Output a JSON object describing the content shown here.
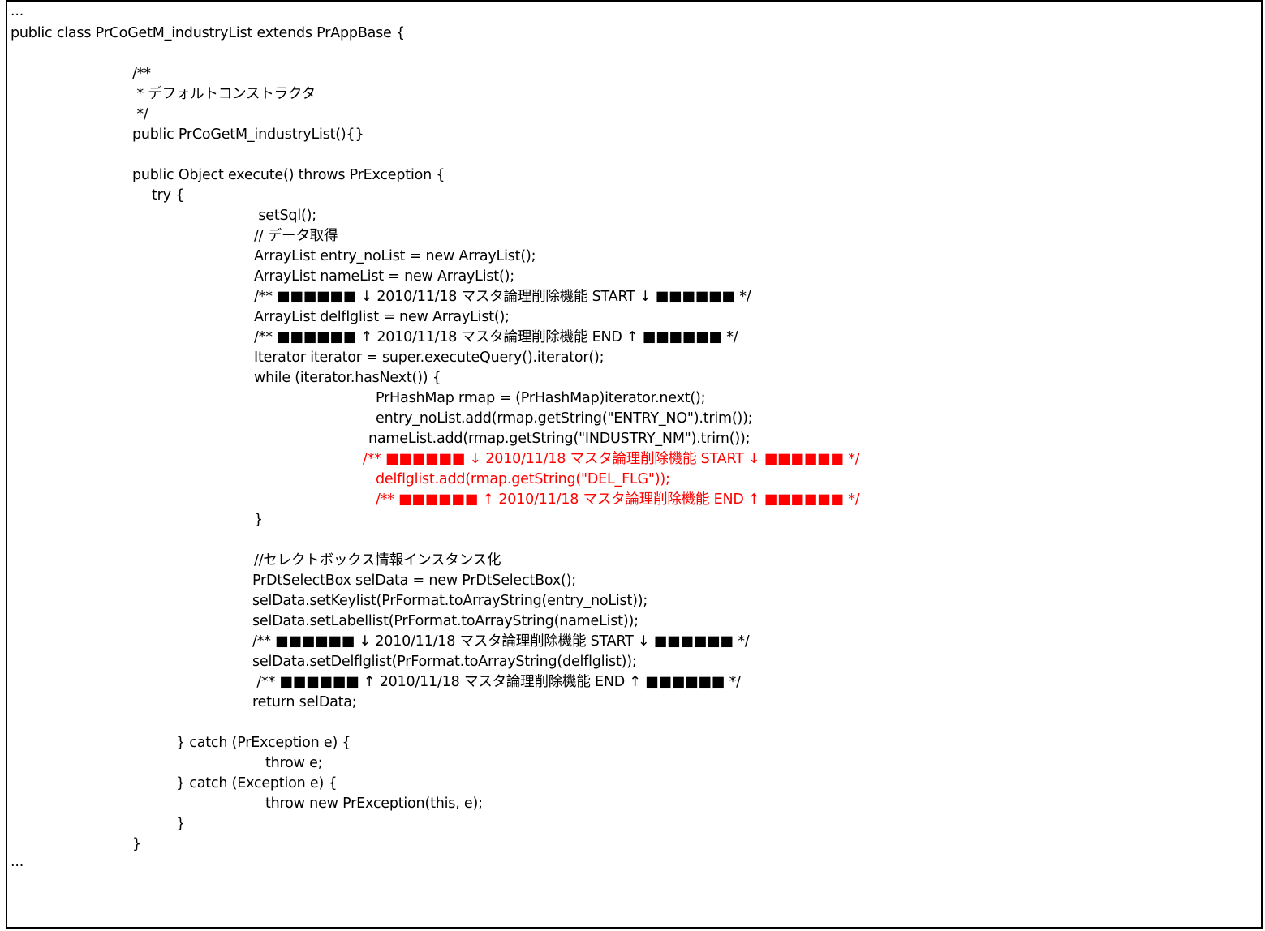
{
  "document": {
    "lines": [
      "...",
      "public class PrCoGetM_industryList extends PrAppBase {",
      "/**",
      " * デフォルトコンストラクタ",
      " */",
      "public PrCoGetM_industryList(){}",
      "public Object execute() throws PrException {",
      "try {",
      " setSql();",
      "// データ取得",
      "ArrayList entry_noList = new ArrayList();",
      "ArrayList nameList = new ArrayList();",
      "/** ■■■■■■ ↓ 2010/11/18 マスタ論理削除機能 START ↓ ■■■■■■ */",
      "ArrayList delflglist = new ArrayList();",
      "/** ■■■■■■ ↑ 2010/11/18 マスタ論理削除機能 END ↑ ■■■■■■ */",
      "Iterator iterator = super.executeQuery().iterator();",
      "while (iterator.hasNext()) {",
      "PrHashMap rmap = (PrHashMap)iterator.next();",
      "entry_noList.add(rmap.getString(\"ENTRY_NO\").trim());",
      "nameList.add(rmap.getString(\"INDUSTRY_NM\").trim());",
      "/** ■■■■■■ ↓ 2010/11/18 マスタ論理削除機能 START ↓ ■■■■■■ */",
      "delflglist.add(rmap.getString(\"DEL_FLG\"));",
      "/** ■■■■■■ ↑ 2010/11/18 マスタ論理削除機能 END ↑ ■■■■■■ */",
      "}",
      "//セレクトボックス情報インスタンス化",
      "PrDtSelectBox selData = new PrDtSelectBox();",
      "selData.setKeylist(PrFormat.toArrayString(entry_noList));",
      "selData.setLabellist(PrFormat.toArrayString(nameList));",
      "/** ■■■■■■ ↓ 2010/11/18 マスタ論理削除機能 START ↓ ■■■■■■ */",
      "selData.setDelflglist(PrFormat.toArrayString(delflglist));",
      " /** ■■■■■■ ↑ 2010/11/18 マスタ論理削除機能 END ↑ ■■■■■■ */",
      "return selData;",
      "} catch (PrException e) {",
      "throw e;",
      "} catch (Exception e) {",
      "throw new PrException(this, e);",
      "}",
      "}",
      "..."
    ],
    "colors": {
      "text": "#000000",
      "highlight": "#ff0000",
      "border": "#000000",
      "background": "#ffffff"
    }
  }
}
